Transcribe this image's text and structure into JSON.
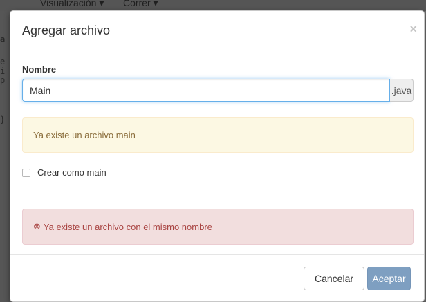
{
  "background": {
    "menu": [
      "Visualización ▾",
      "Correr ▾"
    ],
    "side_chars": [
      "a",
      "e",
      "i",
      "p",
      "}"
    ]
  },
  "modal": {
    "title": "Agregar archivo",
    "close": "×",
    "name_label": "Nombre",
    "name_value": "Main",
    "extension": ".java",
    "warning": "Ya existe un archivo main",
    "checkbox_label": "Crear como main",
    "error_icon": "⊗",
    "error": "Ya existe un archivo con el mismo nombre",
    "cancel_label": "Cancelar",
    "accept_label": "Aceptar"
  },
  "colors": {
    "accept_button": "#7e9fc1",
    "warning_bg": "#fcf8e3",
    "danger_bg": "#f2dede"
  }
}
